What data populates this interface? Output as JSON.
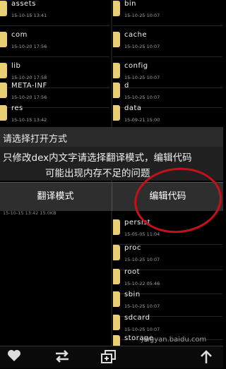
{
  "left_files": [
    {
      "name": "assets",
      "date": "15-10-15 13:41"
    },
    {
      "name": "com",
      "date": "15-10-20 17:56"
    },
    {
      "name": "lib",
      "date": "15-10-20 17:58"
    },
    {
      "name": "META-INF",
      "date": "15-10-20 17:56"
    },
    {
      "name": "res",
      "date": "15-10-15 13:42"
    }
  ],
  "right_files": [
    {
      "name": "bin",
      "date": "15-10-25 10:07"
    },
    {
      "name": "cache",
      "date": "15-10-25 10:07"
    },
    {
      "name": "config",
      "date": "15-10-25 10:07"
    },
    {
      "name": "d",
      "date": "15-10-25 10:07"
    },
    {
      "name": "data",
      "date": "15-09-21 15:00"
    }
  ],
  "right_files_lower": [
    {
      "name": "persist",
      "date": "15-05-05 11:04"
    },
    {
      "name": "proc",
      "date": "15-10-25 10:07"
    },
    {
      "name": "root",
      "date": "15-10-22 05:46"
    },
    {
      "name": "sbin",
      "date": "15-10-25 10:07"
    },
    {
      "name": "sdcard",
      "date": "15-10-25 10:07"
    },
    {
      "name": "storage",
      "date": ""
    }
  ],
  "partial_left_date": "15-10-15 13:42 15.0KB",
  "dialog": {
    "title": "请选择打开方式",
    "message_line1": "只修改dex内文字请选择翻译模式，编辑代码",
    "message_line2": "可能出现内存不足的问题",
    "button_translate": "翻译模式",
    "button_edit": "编辑代码"
  },
  "watermark": "jingyan.baidu.com",
  "colors": {
    "folder": "#e9cf73",
    "annotation_circle": "#c8101a"
  }
}
